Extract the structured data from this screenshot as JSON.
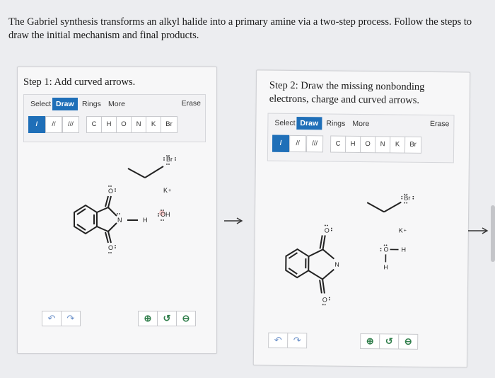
{
  "question": "The Gabriel synthesis transforms an alkyl halide into a primary amine via a two-step process. Follow the steps to draw the initial mechanism and final products.",
  "step1": {
    "title": "Step 1: Add curved arrows.",
    "tabs": [
      "Select",
      "Draw",
      "Rings",
      "More"
    ],
    "active_tab": "Draw",
    "erase_label": "Erase",
    "bond_tools": [
      "/",
      "//",
      "///"
    ],
    "atom_tools": [
      "C",
      "H",
      "O",
      "N",
      "K",
      "Br"
    ],
    "labels": {
      "br": "Br",
      "k": "K",
      "oh": "OH",
      "n": "N",
      "h": "H",
      "o_top": "O",
      "o_bot": "O",
      "plus": "+"
    }
  },
  "step2": {
    "title": "Step 2: Draw the missing nonbonding electrons, charge and curved arrows.",
    "tabs": [
      "Select",
      "Draw",
      "Rings",
      "More"
    ],
    "active_tab": "Draw",
    "erase_label": "Erase",
    "bond_tools": [
      "/",
      "//",
      "///"
    ],
    "atom_tools": [
      "C",
      "H",
      "O",
      "N",
      "K",
      "Br"
    ],
    "labels": {
      "br": "Br",
      "k": "K",
      "o": "O",
      "h1": "H",
      "h2": "H",
      "n": "N",
      "o_top": "O",
      "o_bot": "O",
      "plus": "+"
    }
  },
  "icons": {
    "undo": "undo-icon",
    "redo": "redo-icon",
    "zoom_in": "zoom-in-icon",
    "reset": "reset-zoom-icon",
    "zoom_out": "zoom-out-icon",
    "next_arrow": "right-arrow-icon"
  },
  "colors": {
    "accent": "#1f6fb8",
    "zoom": "#2f7d4a",
    "undo": "#6a8fc8"
  }
}
